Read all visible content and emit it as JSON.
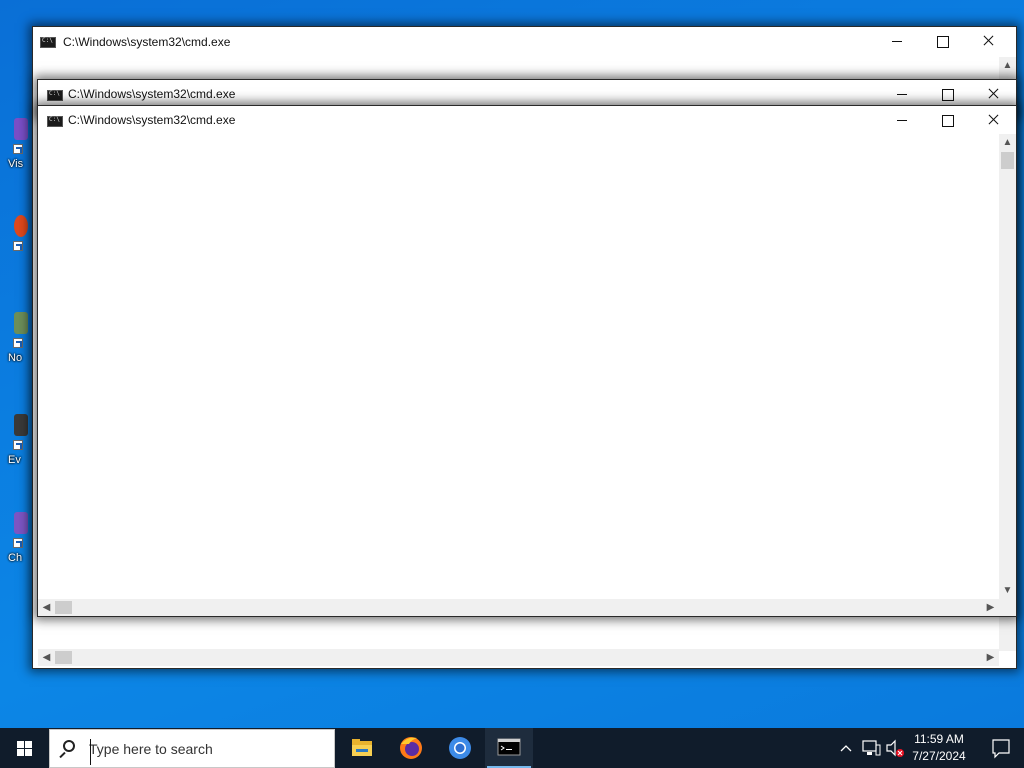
{
  "desktop": {
    "icons": [
      {
        "label": "Vis",
        "color": "#7a4fc7"
      },
      {
        "label": "",
        "color": "#e0491d"
      },
      {
        "label": "No",
        "color": "#6d8f5a"
      },
      {
        "label": "Ev",
        "color": "#3a3a3a"
      },
      {
        "label": "Ch",
        "color": "#7d56c4"
      }
    ]
  },
  "windows": [
    {
      "title": "C:\\Windows\\system32\\cmd.exe"
    },
    {
      "title": "C:\\Windows\\system32\\cmd.exe"
    },
    {
      "title": "C:\\Windows\\system32\\cmd.exe"
    }
  ],
  "taskbar": {
    "search_placeholder": "Type here to search",
    "apps": [
      "file-explorer",
      "firefox",
      "chrome",
      "command-prompt"
    ],
    "active_app": "command-prompt",
    "time": "11:59 AM",
    "date": "7/27/2024"
  },
  "colors": {
    "desktop_blue": "#0b7de0",
    "taskbar": "#101c2b",
    "active_indicator": "#76b9ed"
  }
}
